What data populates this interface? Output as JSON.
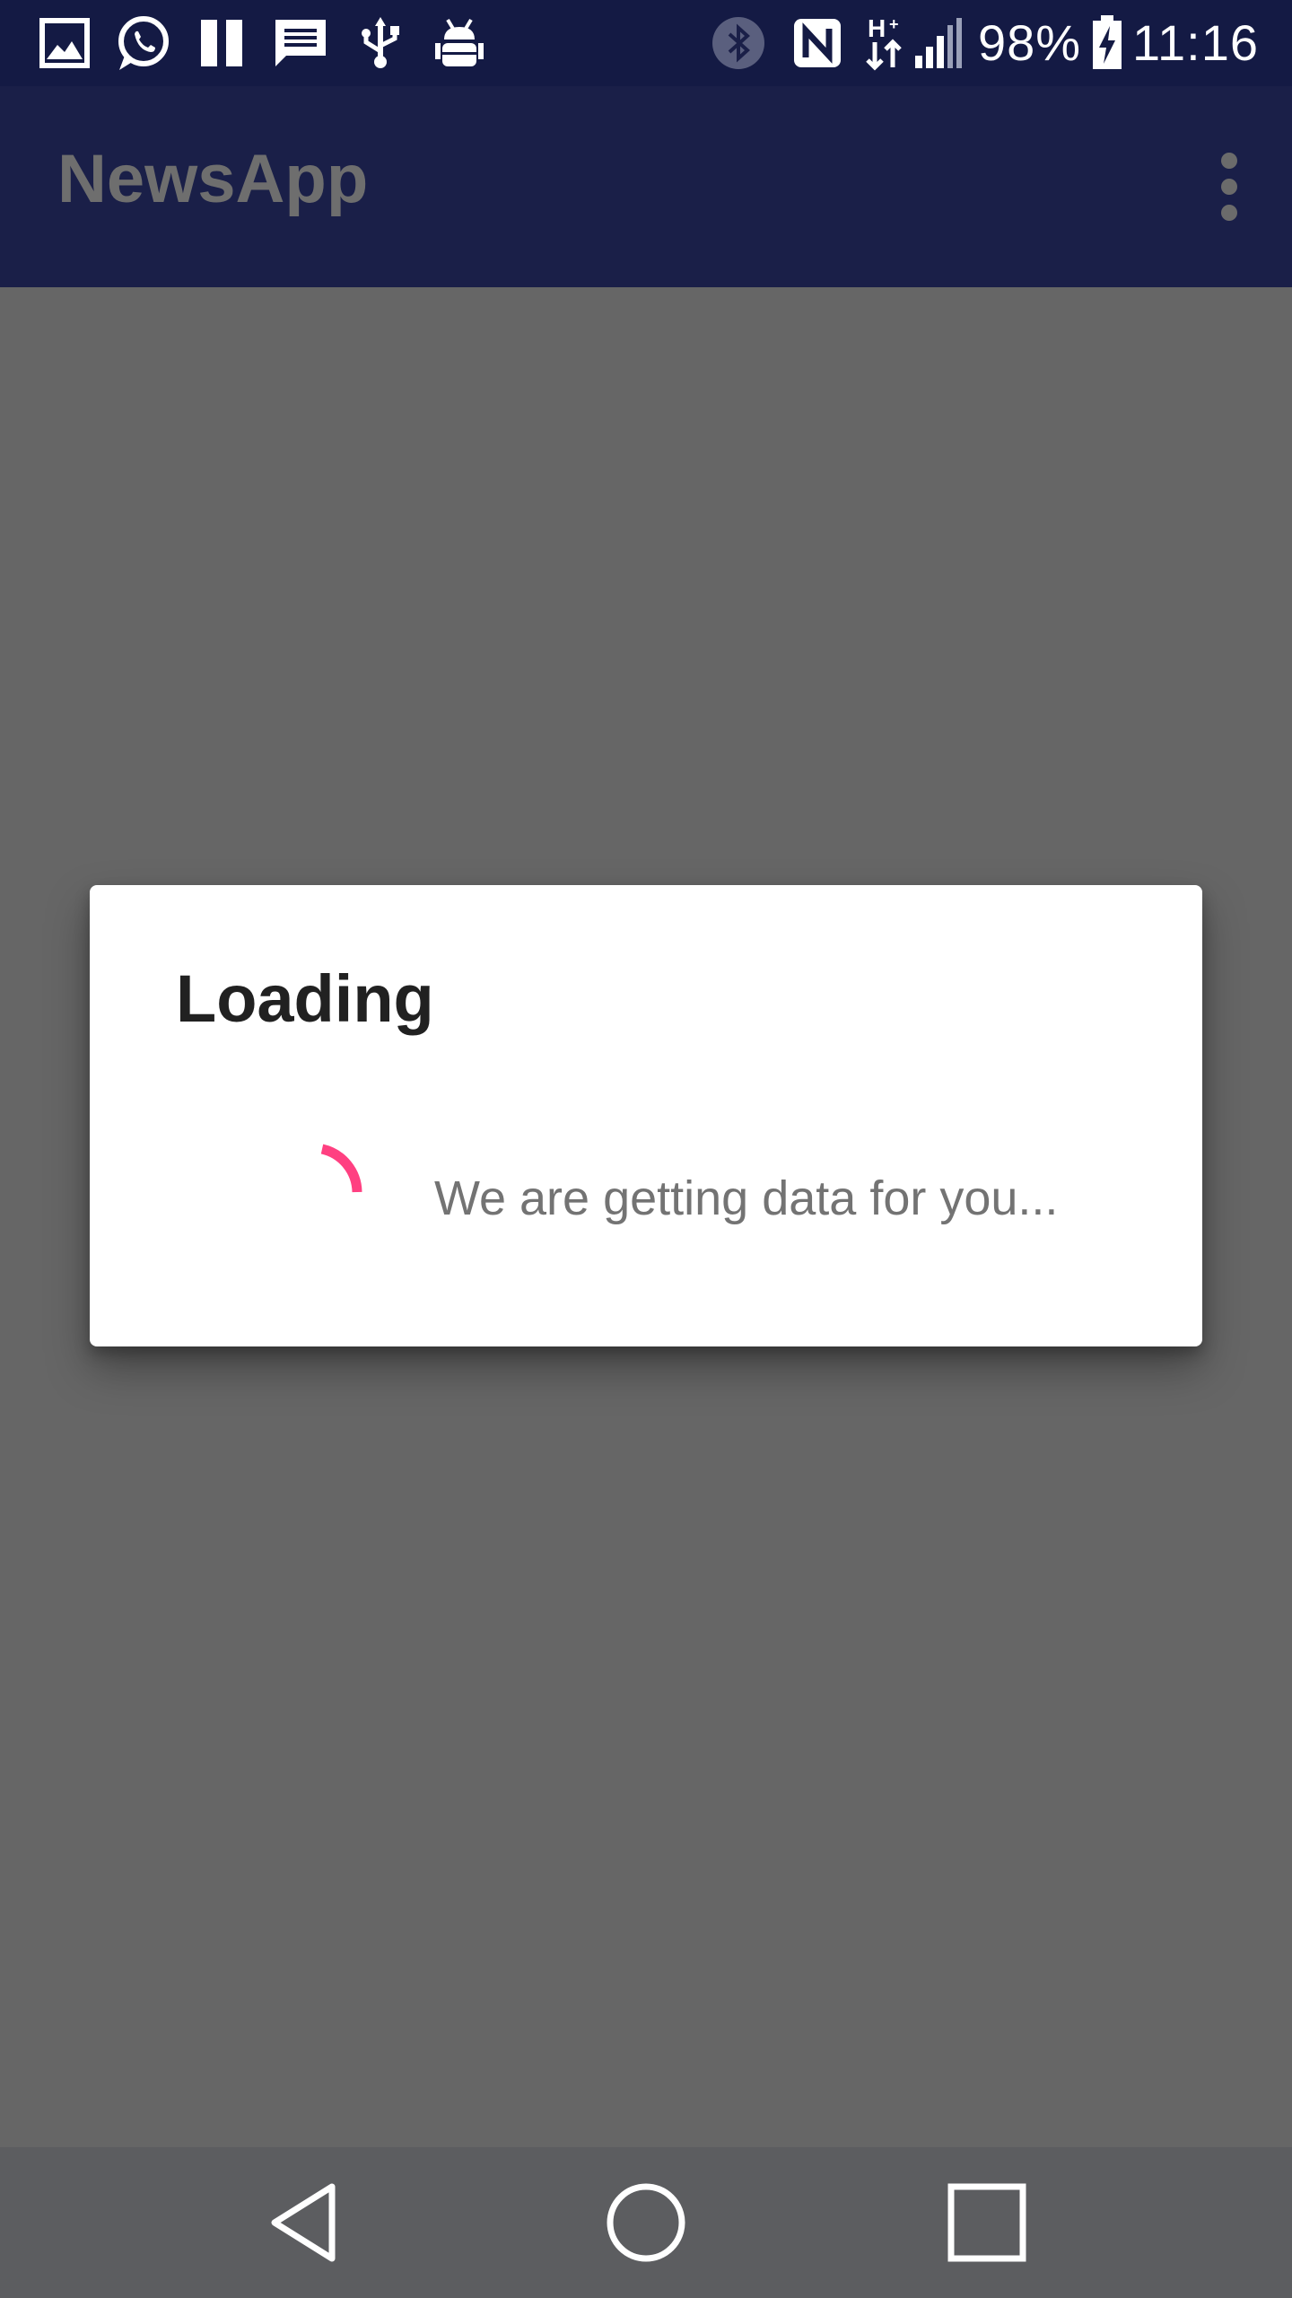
{
  "status_bar": {
    "battery_text": "98%",
    "time": "11:16",
    "left_icons": [
      "gallery-icon",
      "whatsapp-icon",
      "pause-icon",
      "message-icon",
      "usb-icon",
      "android-debug-icon"
    ],
    "right_icons": [
      "bluetooth-icon",
      "nfc-icon",
      "hplus-data-icon",
      "signal-icon",
      "battery-charging-icon"
    ]
  },
  "app_bar": {
    "title": "NewsApp",
    "overflow_icon": "more-vert-icon"
  },
  "dialog": {
    "title": "Loading",
    "message": "We are getting data for you...",
    "spinner_color": "#ff4081"
  },
  "nav_bar": {
    "icons": [
      "back-icon",
      "home-icon",
      "recents-icon"
    ]
  },
  "colors": {
    "status_bar": "#141a44",
    "app_bar": "#1a1f48",
    "scrim": "#666666",
    "accent": "#ff4081"
  }
}
